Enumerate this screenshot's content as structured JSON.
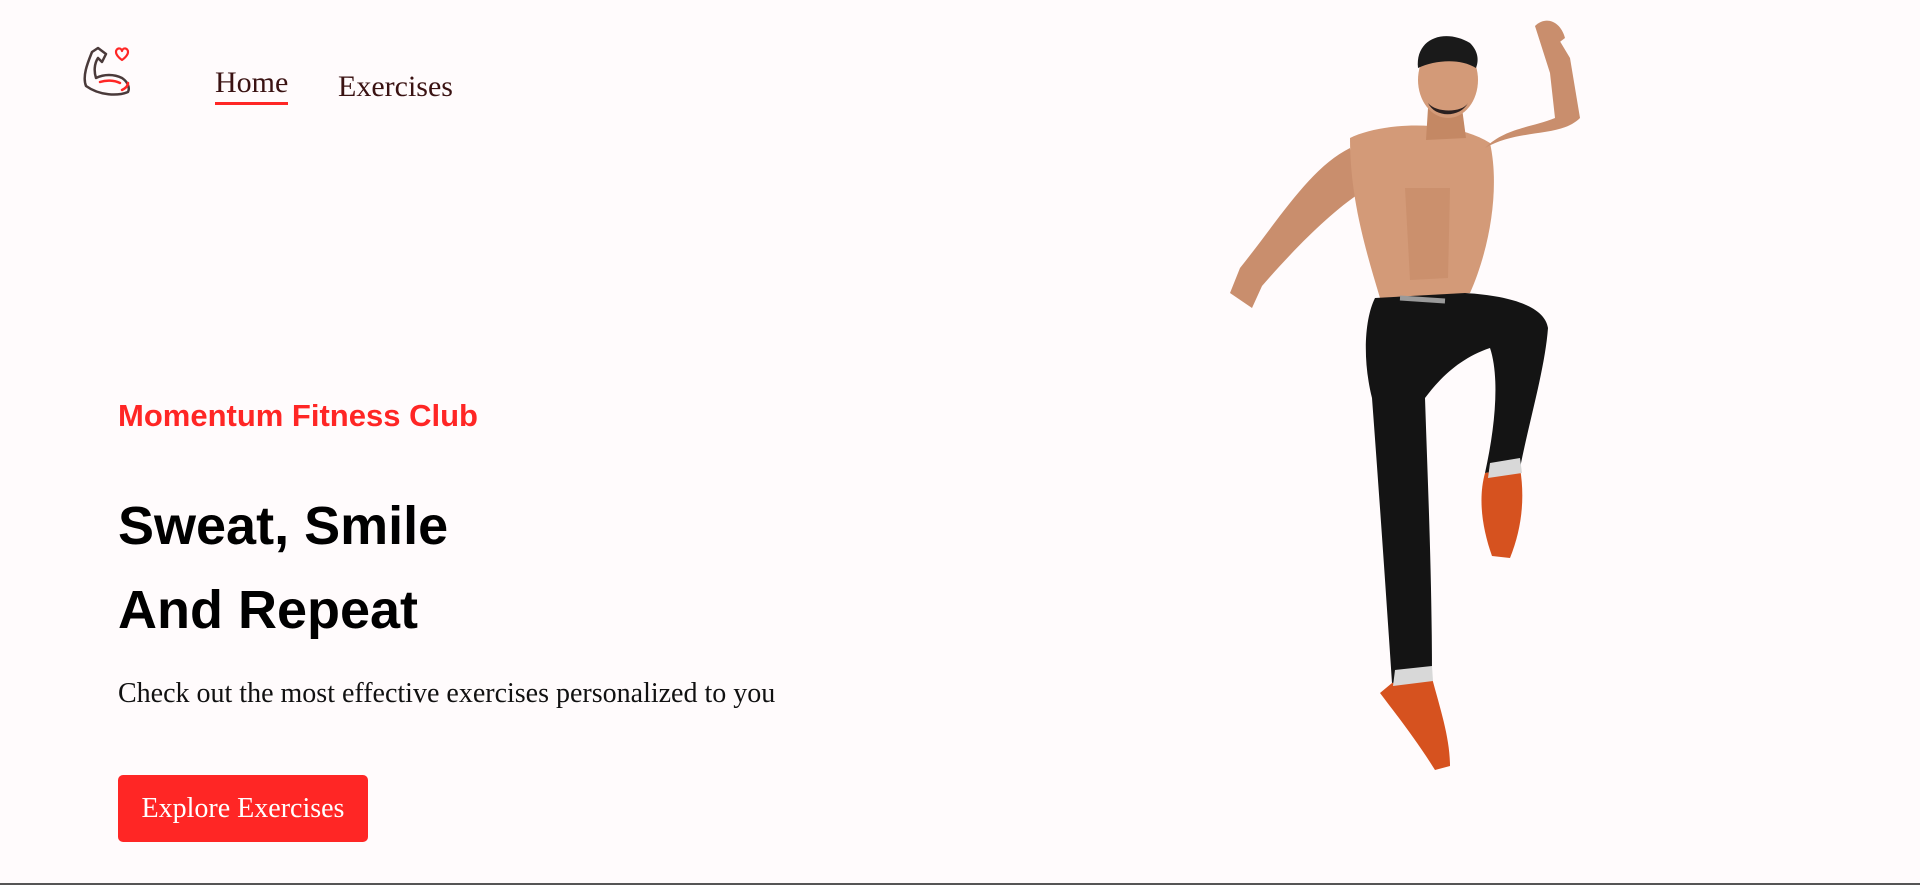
{
  "nav": {
    "links": [
      {
        "label": "Home",
        "active": true
      },
      {
        "label": "Exercises",
        "active": false
      }
    ],
    "logo_icon": "flexed-bicep-heart-icon"
  },
  "hero": {
    "club_name": "Momentum Fitness Club",
    "headline_line1": "Sweat, Smile",
    "headline_line2": "And Repeat",
    "subtitle": "Check out the most effective exercises personalized to you",
    "cta_label": "Explore Exercises",
    "image": "athlete-jumping-image"
  },
  "colors": {
    "accent": "#ff2625",
    "background": "#fffbfc",
    "text": "#000000",
    "nav_text": "#3a1212"
  }
}
